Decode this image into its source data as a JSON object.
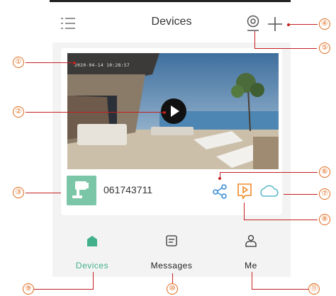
{
  "header": {
    "title": "Devices",
    "icons": {
      "menu": "menu-lines-icon",
      "add_camera": "camera-pin-icon",
      "add": "plus-icon"
    }
  },
  "device_card": {
    "timestamp": "2020-04-14 10:28:57",
    "device_name": "061743711",
    "actions": [
      "share-icon",
      "playback-icon",
      "cloud-icon"
    ]
  },
  "tabbar": {
    "tabs": [
      {
        "label": "Devices",
        "icon": "home-icon",
        "active": true
      },
      {
        "label": "Messages",
        "icon": "message-icon",
        "active": false
      },
      {
        "label": "Me",
        "icon": "person-icon",
        "active": false
      }
    ]
  },
  "callouts": [
    "①",
    "②",
    "③",
    "④",
    "⑤",
    "⑥",
    "⑦",
    "⑧",
    "⑨",
    "⑩",
    "⑪"
  ],
  "colors": {
    "accent": "#41b08b",
    "callout": "#e06a1b",
    "leader": "#c42020",
    "cloud": "#5bb8c9",
    "playback": "#f0892a",
    "share": "#3b8ed6"
  }
}
